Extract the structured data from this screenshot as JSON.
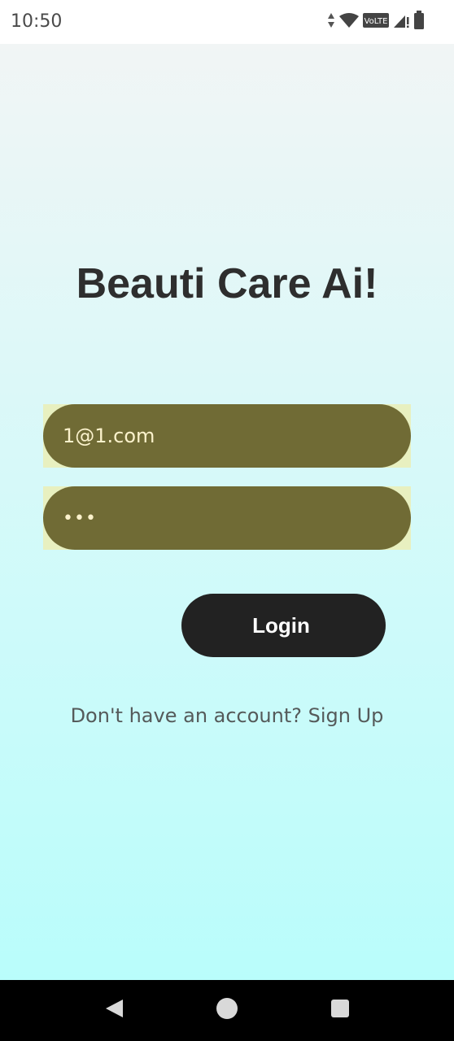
{
  "status_bar": {
    "time": "10:50",
    "icons": [
      "data-arrows-icon",
      "wifi-icon",
      "volte-icon",
      "signal-icon",
      "battery-icon"
    ],
    "volte_label": "VoLTE"
  },
  "app": {
    "title": "Beauti Care Ai!"
  },
  "form": {
    "email_value": "1@1.com",
    "password_value": "•••",
    "login_label": "Login",
    "signup_prompt": "Don't have an account? Sign Up"
  },
  "colors": {
    "field_background": "#706b35",
    "field_text": "#fbf2cc",
    "button_background": "#222222",
    "gradient_top": "#f1f5f5",
    "gradient_bottom": "#b9fdfb"
  },
  "nav_bar": {
    "buttons": [
      "back-icon",
      "home-icon",
      "recents-icon"
    ]
  }
}
